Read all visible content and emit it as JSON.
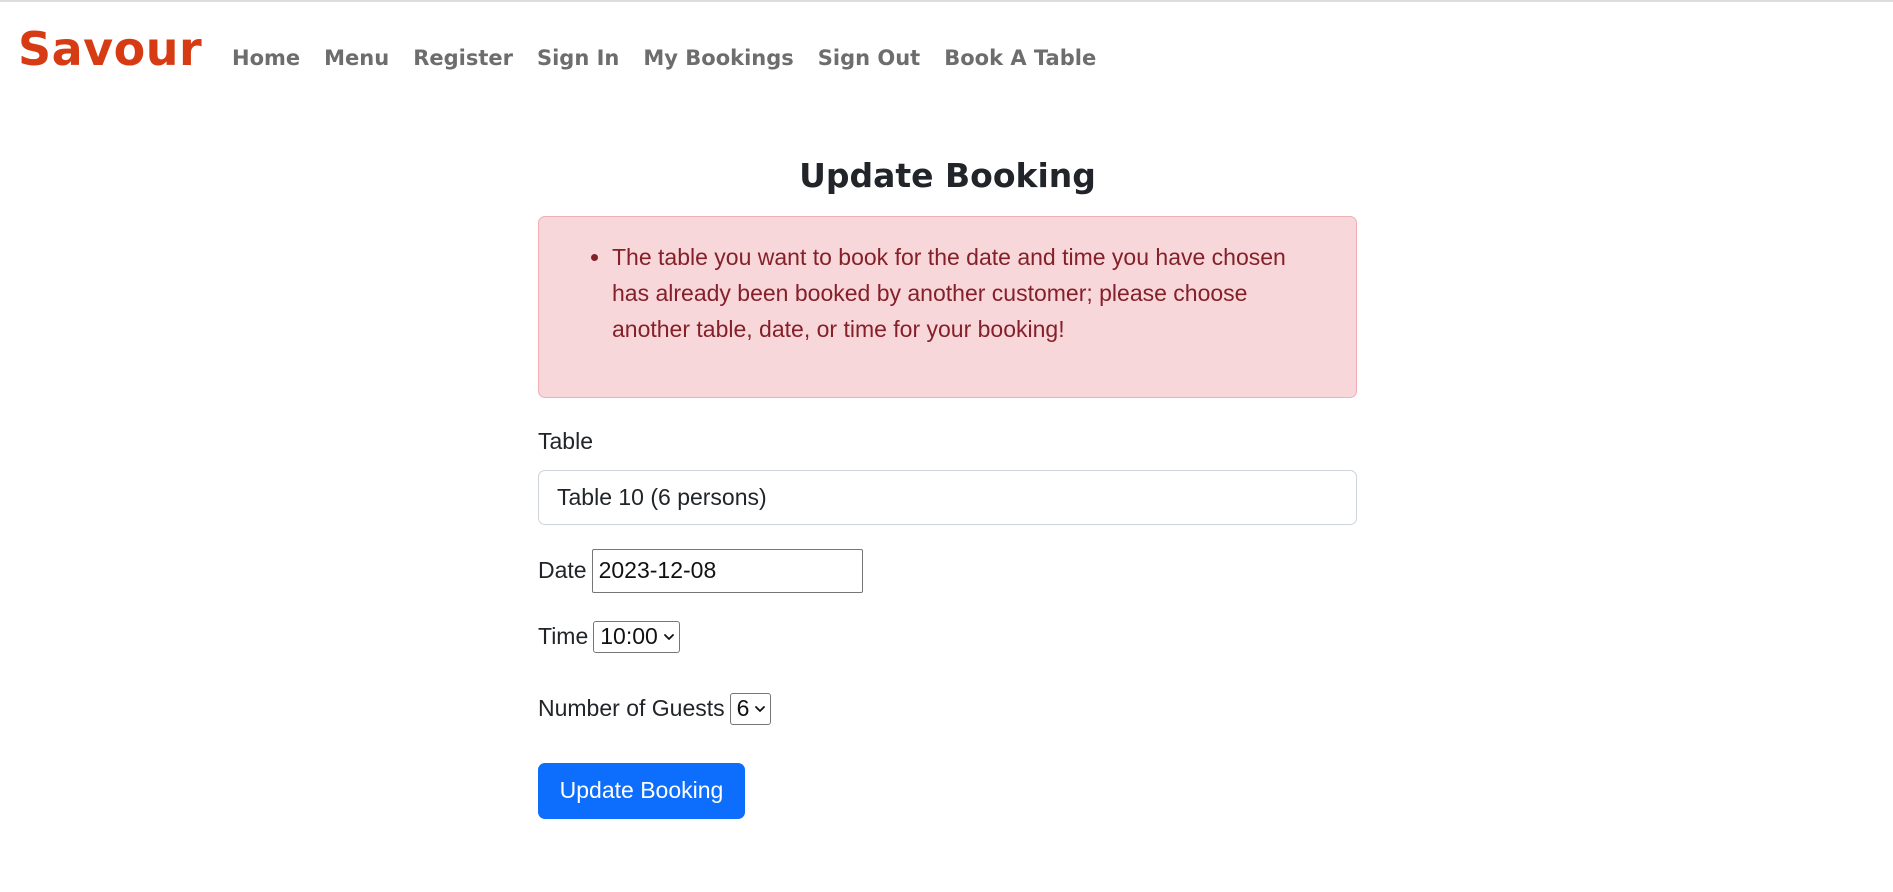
{
  "nav": {
    "brand": "Savour",
    "brand_color": "#d63b14",
    "links": [
      {
        "label": "Home"
      },
      {
        "label": "Menu"
      },
      {
        "label": "Register"
      },
      {
        "label": "Sign In"
      },
      {
        "label": "My Bookings"
      },
      {
        "label": "Sign Out"
      },
      {
        "label": "Book A Table"
      }
    ]
  },
  "main": {
    "title": "Update Booking",
    "alert": {
      "message": "The table you want to book for the date and time you have chosen has already been booked by another customer; please choose another table, date, or time for your booking!",
      "background": "#f8d7da",
      "text_color": "#842029"
    },
    "form": {
      "table": {
        "label": "Table",
        "value": "Table 10 (6 persons)"
      },
      "date": {
        "label": "Date",
        "value": "2023-12-08"
      },
      "time": {
        "label": "Time",
        "value": "10:00",
        "icon": "chevron-down-icon"
      },
      "guests": {
        "label": "Number of Guests",
        "value": "6",
        "icon": "chevron-down-icon"
      },
      "submit_label": "Update Booking",
      "submit_color": "#0d6efd"
    }
  }
}
